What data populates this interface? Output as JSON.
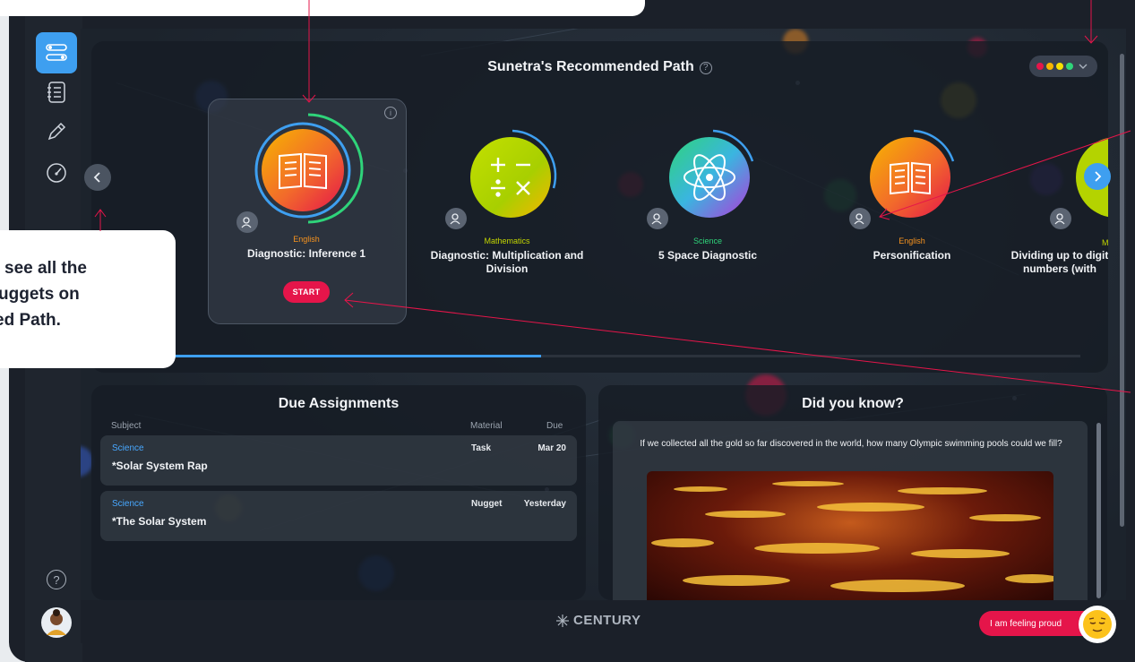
{
  "path_panel": {
    "title": "Sunetra's Recommended Path",
    "help_glyph": "?",
    "colour_dots": [
      "#e5154a",
      "#f7b500",
      "#f7e000",
      "#2fd47a"
    ],
    "start_label": "START",
    "info_glyph": "i",
    "progress_fraction": 0.41,
    "nuggets": [
      {
        "subject": "English",
        "subject_color": "#f7931e",
        "title": "Diagnostic: Inference 1",
        "icon": "open-book-icon"
      },
      {
        "subject": "Mathematics",
        "subject_color": "#c3d600",
        "title": "Diagnostic: Multiplication and Division",
        "icon": "math-operators-icon"
      },
      {
        "subject": "Science",
        "subject_color": "#2fd47a",
        "title": "5 Space Diagnostic",
        "icon": "atom-icon"
      },
      {
        "subject": "English",
        "subject_color": "#f7931e",
        "title": "Personification",
        "icon": "open-book-icon"
      },
      {
        "subject": "M",
        "subject_color": "#c3d600",
        "title": "Dividing up to digit numbers (with",
        "icon": "math-operators-icon"
      }
    ]
  },
  "due_assignments": {
    "title": "Due Assignments",
    "headers": {
      "subject": "Subject",
      "material": "Material",
      "due": "Due"
    },
    "rows": [
      {
        "subject": "Science",
        "name": "*Solar System Rap",
        "material": "Task",
        "due": "Mar 20"
      },
      {
        "subject": "Science",
        "name": "*The Solar System",
        "material": "Nugget",
        "due": "Yesterday"
      }
    ]
  },
  "did_you_know": {
    "title": "Did you know?",
    "question": "If we collected all the gold so far discovered in the world, how many Olympic swimming pools could we fill?"
  },
  "footer": {
    "brand": "CENTURY",
    "feeling_label": "I am feeling proud",
    "help_glyph": "?"
  },
  "callout": {
    "line1": "see all the",
    "line2": "uggets on",
    "line3": "ed Path."
  },
  "colors": {
    "accent_blue": "#3e9ff0",
    "accent_red": "#e5154a"
  }
}
